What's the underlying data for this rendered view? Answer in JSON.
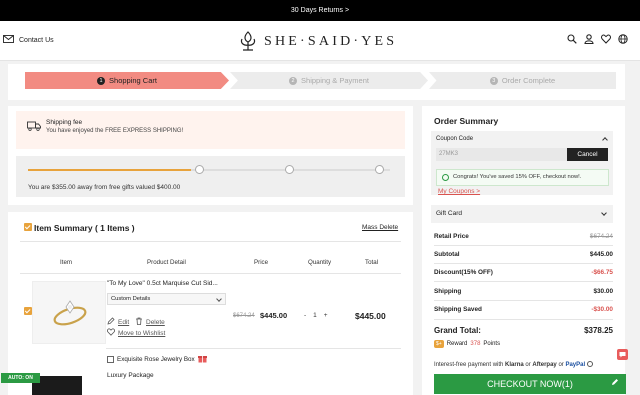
{
  "topbar": {
    "text": "30 Days Returns >"
  },
  "header": {
    "contact": "Contact Us",
    "logo": "SHE·SAID·YES",
    "icons": [
      "search-icon",
      "user-icon",
      "heart-icon",
      "globe-icon"
    ]
  },
  "steps": [
    {
      "num": "1",
      "label": "Shopping Cart"
    },
    {
      "num": "2",
      "label": "Shipping & Payment"
    },
    {
      "num": "3",
      "label": "Order Complete"
    }
  ],
  "shipping": {
    "title": "Shipping fee",
    "desc": "You have enjoyed the FREE EXPRESS SHIPPING!"
  },
  "gift_progress": {
    "progress": 0.45,
    "text": "You are $355.00 away from free gifts valued $400.00"
  },
  "summary": {
    "title": "Item Summary ( 1 Items )",
    "mass_delete": "Mass Delete",
    "columns": [
      "Item",
      "Product Detail",
      "Price",
      "Quantity",
      "Total"
    ]
  },
  "item": {
    "name": "\"To My Love\" 0.5ct Marquise Cut Sid...",
    "select": "Custom Details",
    "edit": "Edit",
    "delete": "Delete",
    "wishlist": "Move to Wishlist",
    "price_old": "$674.24",
    "price_new": "$445.00",
    "qty_minus": "-",
    "qty": "1",
    "qty_plus": "+",
    "total": "$445.00",
    "gift_box": "Exquisite Rose Jewelry Box",
    "luxury": "Luxury Package"
  },
  "auto_on": "AUTO: ON",
  "order_summary": {
    "title": "Order Summary",
    "coupon_label": "Coupon Code",
    "coupon_value": "27MK3",
    "cancel": "Cancel",
    "success": "Congrats! You've saved 15% OFF, checkout now!.",
    "my_coupons": "My Coupons >",
    "gift_card": "Gift Card",
    "rows": [
      {
        "label": "Retail Price",
        "value": "$674.24"
      },
      {
        "label": "Subtotal",
        "value": "$445.00"
      },
      {
        "label": "Discount(15% OFF)",
        "value": "-$66.75"
      },
      {
        "label": "Shipping",
        "value": "$30.00"
      },
      {
        "label": "Shipping Saved",
        "value": "-$30.00"
      }
    ],
    "grand_label": "Grand Total:",
    "grand_value": "$378.25",
    "reward_badge": "$+",
    "reward_pre": "Reward",
    "reward_points": "378",
    "reward_post": "Points",
    "pay_pre": "Interest-free payment with",
    "pay_klarna": "Klarna",
    "pay_or1": "or",
    "pay_afterpay": "Afterpay",
    "pay_or2": "or",
    "pay_paypal": "PayPal",
    "checkout": "CHECKOUT NOW(1)"
  },
  "colors": {
    "accent": "#f28b82",
    "green": "#2b9a43",
    "orange": "#e8a33c",
    "red": "#d9534f"
  }
}
